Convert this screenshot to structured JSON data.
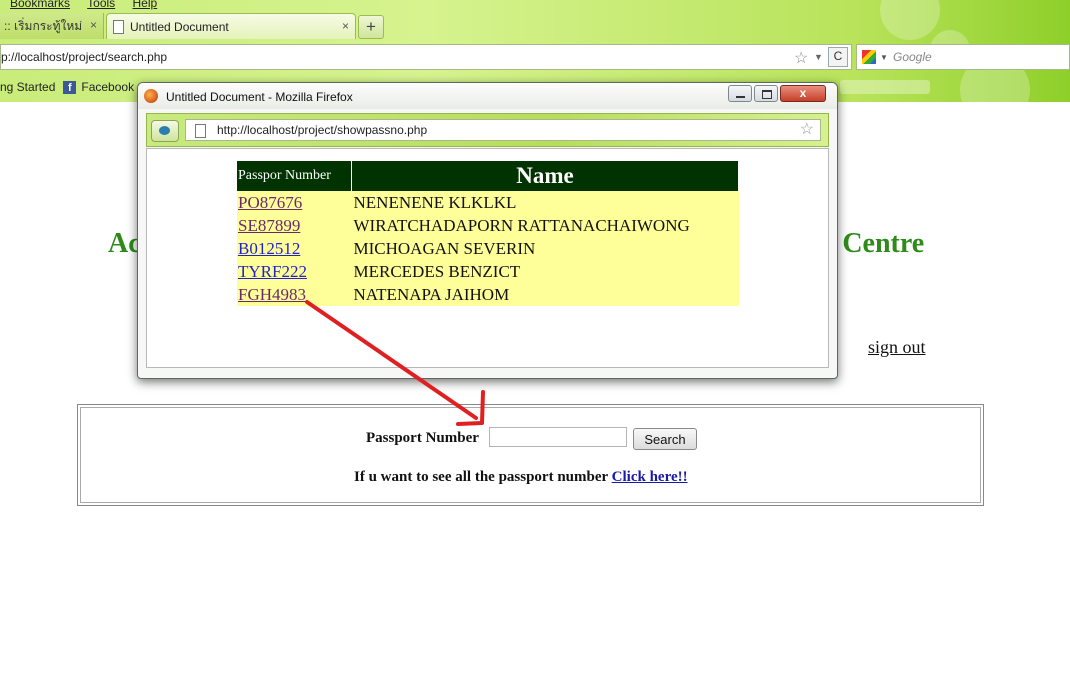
{
  "browser": {
    "menu": [
      "Bookmarks",
      "Tools",
      "Help"
    ],
    "tabs": [
      {
        "label": ":: เริ่มกระทู้ใหม่"
      },
      {
        "label": "Untitled Document"
      }
    ],
    "new_tab": "+",
    "tab_close": "×",
    "url": "p://localhost/project/search.php",
    "search_placeholder": "Google",
    "bookmarks": [
      "ng Started",
      "Facebook"
    ]
  },
  "page": {
    "heading_left": "Ac",
    "heading_right": "t Centre",
    "sign_out": "sign out",
    "passport_label": "Passport Number",
    "search_button": "Search",
    "all_prefix": "If u want to see all the passport number",
    "all_link": "Click here!!"
  },
  "popup": {
    "title": "Untitled Document - Mozilla Firefox",
    "close": "x",
    "url": "http://localhost/project/showpassno.php",
    "table": {
      "headers": [
        "Passpor Number",
        "Name"
      ],
      "rows": [
        {
          "passport": "PO87676",
          "name": "NENENENE KLKLKL",
          "link_state": "visited"
        },
        {
          "passport": "SE87899",
          "name": "WIRATCHADAPORN RATTANACHAIWONG",
          "link_state": "visited"
        },
        {
          "passport": "B012512",
          "name": "MICHOAGAN SEVERIN",
          "link_state": "unvisited"
        },
        {
          "passport": "TYRF222",
          "name": "MERCEDES BENZICT",
          "link_state": "unvisited"
        },
        {
          "passport": "FGH4983",
          "name": "NATENAPA JAIHOM",
          "link_state": "visited"
        }
      ]
    }
  },
  "colors": {
    "heading_green": "#2e8b1a",
    "table_header_bg": "#003300",
    "table_row_bg": "#ffff99",
    "annotation_arrow": "#e02020"
  }
}
